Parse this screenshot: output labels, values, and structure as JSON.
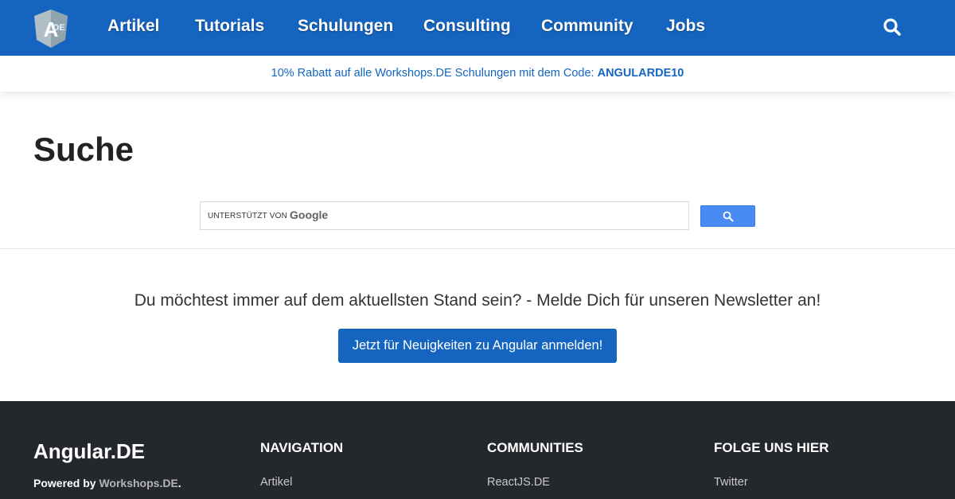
{
  "nav": {
    "items": [
      "Artikel",
      "Tutorials",
      "Schulungen",
      "Consulting",
      "Community",
      "Jobs"
    ],
    "search_icon": "search-icon",
    "logo_letters": "DE",
    "accent_color": "#1565c0"
  },
  "promo": {
    "text": "10% Rabatt auf alle Workshops.DE Schulungen mit dem Code: ",
    "code": "ANGULARDE10"
  },
  "main": {
    "title": "Suche",
    "search": {
      "prefix": "UNTERSTÜTZT VON",
      "brand": "Google",
      "button_icon": "search-icon",
      "button_color": "#4a8af4"
    }
  },
  "newsletter": {
    "text": "Du möchtest immer auf dem aktuellsten Stand sein? - Melde Dich für unseren Newsletter an!",
    "button_label": "Jetzt für Neuigkeiten zu Angular anmelden!"
  },
  "footer": {
    "brand": "Angular.DE",
    "powered_prefix": "Powered by ",
    "powered_link": "Workshops.DE",
    "powered_suffix": ".",
    "columns": [
      {
        "heading": "NAVIGATION",
        "first_link": "Artikel"
      },
      {
        "heading": "COMMUNITIES",
        "first_link": "ReactJS.DE"
      },
      {
        "heading": "FOLGE UNS HIER",
        "first_link": "Twitter"
      }
    ],
    "background": "#24272b"
  }
}
